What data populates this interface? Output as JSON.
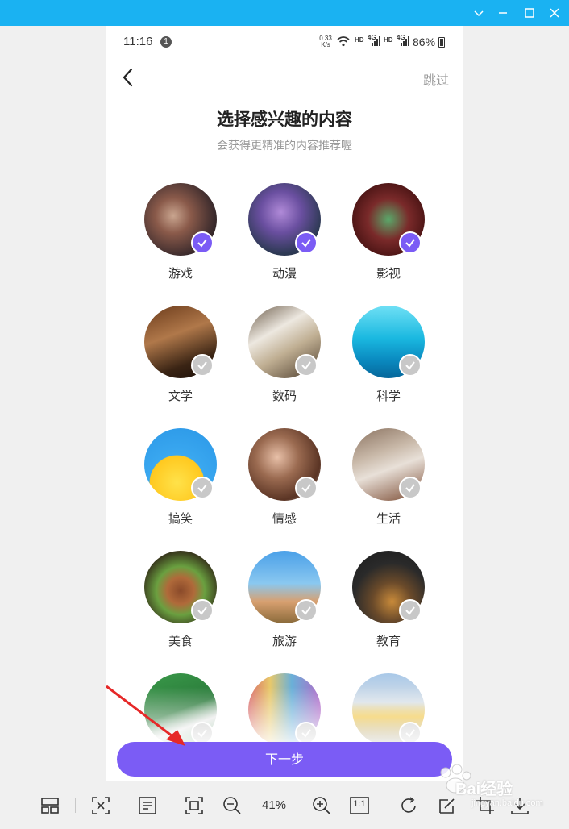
{
  "status_bar": {
    "time": "11:16",
    "notification_count": "1",
    "speed_value": "0.33",
    "speed_unit": "K/s",
    "network_hd_1": "HD",
    "network_4g_1": "4G",
    "network_hd_2": "HD",
    "network_4g_2": "4G",
    "battery": "86%"
  },
  "nav": {
    "skip_label": "跳过"
  },
  "header": {
    "title": "选择感兴趣的内容",
    "subtitle": "会获得更精准的内容推荐喔"
  },
  "categories": [
    {
      "label": "游戏",
      "selected": true,
      "icon": "gaming-photo"
    },
    {
      "label": "动漫",
      "selected": true,
      "icon": "anime-photo"
    },
    {
      "label": "影视",
      "selected": true,
      "icon": "movie-photo"
    },
    {
      "label": "文学",
      "selected": false,
      "icon": "books-photo"
    },
    {
      "label": "数码",
      "selected": false,
      "icon": "tablet-photo"
    },
    {
      "label": "科学",
      "selected": false,
      "icon": "lab-photo"
    },
    {
      "label": "搞笑",
      "selected": false,
      "icon": "cartoon-face-photo"
    },
    {
      "label": "情感",
      "selected": false,
      "icon": "hug-photo"
    },
    {
      "label": "生活",
      "selected": false,
      "icon": "home-decor-photo"
    },
    {
      "label": "美食",
      "selected": false,
      "icon": "steak-photo"
    },
    {
      "label": "旅游",
      "selected": false,
      "icon": "signpost-photo"
    },
    {
      "label": "教育",
      "selected": false,
      "icon": "blackboard-photo"
    }
  ],
  "partial_row": [
    {
      "icon": "sports-photo"
    },
    {
      "icon": "art-photo"
    },
    {
      "icon": "car-photo"
    }
  ],
  "next_button_label": "下一步",
  "viewer": {
    "zoom": "41%",
    "actual_size_label": "1:1",
    "watermark": "Bai经验",
    "watermark_sub": "jingyan.baidu.com"
  },
  "colors": {
    "accent": "#7b5cf5",
    "titlebar": "#1ab2f2"
  }
}
